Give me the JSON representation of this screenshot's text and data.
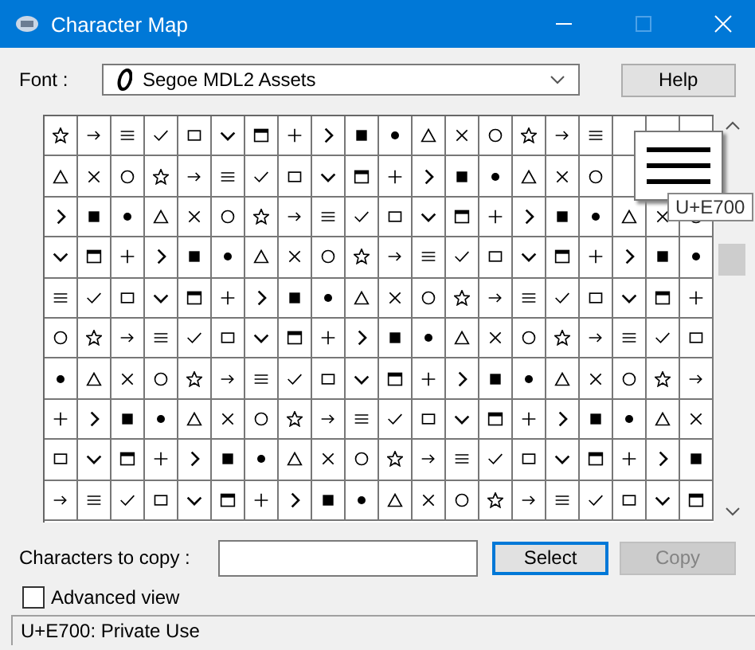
{
  "window": {
    "title": "Character Map"
  },
  "font": {
    "label": "Font :",
    "value": "Segoe MDL2 Assets"
  },
  "help_button": "Help",
  "magnifier": {
    "code": "U+E700"
  },
  "copy_row": {
    "label": "Characters to copy :"
  },
  "buttons": [
    {
      "label": "Select",
      "disabled": false,
      "focused": true
    },
    {
      "label": "Copy",
      "disabled": true,
      "focused": false
    }
  ],
  "advanced_view": {
    "label": "Advanced view",
    "checked": false
  },
  "status_bar": "U+E700: Private Use"
}
